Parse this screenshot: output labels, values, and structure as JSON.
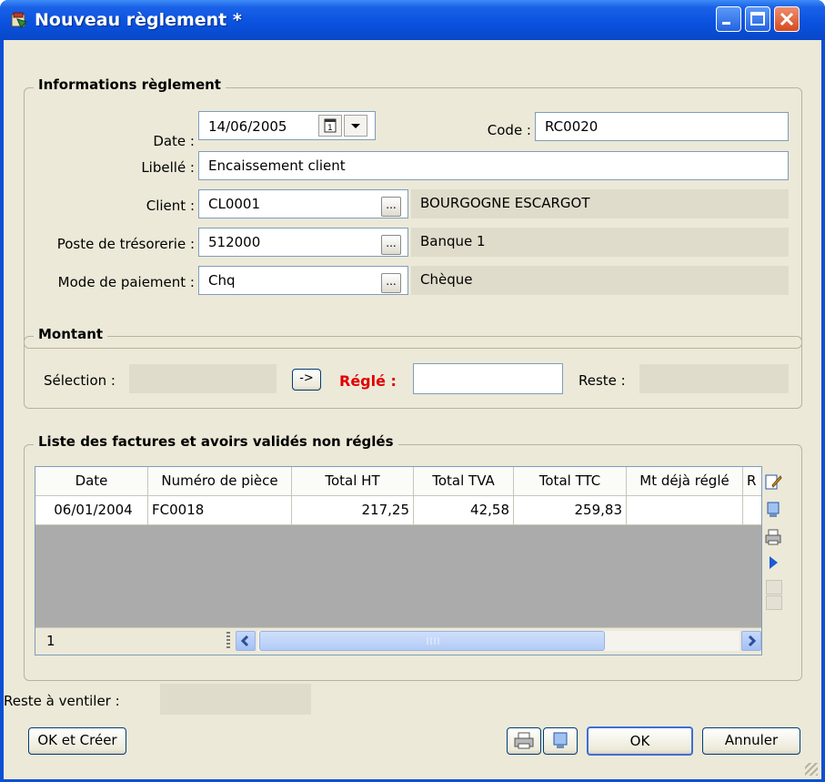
{
  "window": {
    "title": "Nouveau règlement *"
  },
  "info_group": {
    "title": "Informations règlement",
    "date_label": "Date :",
    "date_value": "14/06/2005",
    "code_label": "Code :",
    "code_value": "RC0020",
    "libelle_label": "Libellé :",
    "libelle_value": "Encaissement client",
    "client_label": "Client :",
    "client_code": "CL0001",
    "client_name": "BOURGOGNE ESCARGOT",
    "poste_label": "Poste de trésorerie :",
    "poste_code": "512000",
    "poste_name": "Banque 1",
    "mode_label": "Mode de paiement :",
    "mode_code": "Chq",
    "mode_name": "Chèque",
    "ellipsis": "..."
  },
  "montant_group": {
    "title": "Montant",
    "selection_label": "Sélection :",
    "selection_value": "",
    "arrow_button": "->",
    "regle_label": "Réglé :",
    "regle_value": "",
    "reste_label": "Reste :",
    "reste_value": ""
  },
  "factures_group": {
    "title": "Liste des factures et avoirs validés non réglés",
    "columns": [
      "Date",
      "Numéro de pièce",
      "Total HT",
      "Total TVA",
      "Total TTC",
      "Mt déjà réglé",
      "R"
    ],
    "rows": [
      {
        "date": "06/01/2004",
        "piece": "FC0018",
        "total_ht": "217,25",
        "total_tva": "42,58",
        "total_ttc": "259,83",
        "deja_regle": "",
        "r": ""
      }
    ],
    "row_count": "1"
  },
  "footer": {
    "reste_ventiler_label": "Reste à ventiler :",
    "reste_ventiler_value": "",
    "ok_creer": "OK et Créer",
    "ok": "OK",
    "annuler": "Annuler"
  },
  "colors": {
    "title_blue": "#0a52e0",
    "dialog_bg": "#ece9d8",
    "regle_red": "#e00000"
  }
}
